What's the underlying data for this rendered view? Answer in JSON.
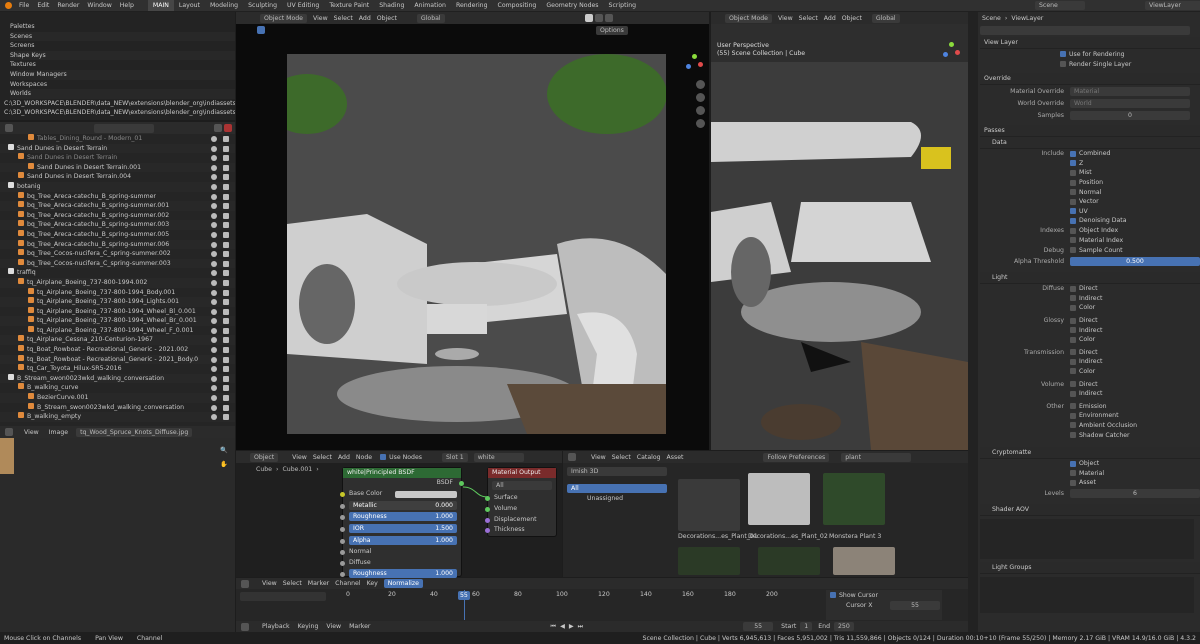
{
  "topbar": {
    "menus": [
      "File",
      "Edit",
      "Render",
      "Window",
      "Help"
    ],
    "workspaces": [
      "MAIN",
      "Layout",
      "Modeling",
      "Sculpting",
      "UV Editing",
      "Texture Paint",
      "Shading",
      "Animation",
      "Rendering",
      "Compositing",
      "Geometry Nodes",
      "Scripting"
    ],
    "active_workspace": "MAIN",
    "scene": "Scene",
    "view_layer": "ViewLayer"
  },
  "blendfile": {
    "items": [
      "Palettes",
      "Scenes",
      "Screens",
      "Shape Keys",
      "Textures",
      "Window Managers",
      "Workspaces",
      "Worlds"
    ],
    "paths": [
      "C:\\3D_WORKSPACE\\BLENDER\\data_NEW\\extensions\\blender_org\\indiassets\\hole_gen",
      "C:\\3D_WORKSPACE\\BLENDER\\data_NEW\\extensions\\blender_org\\indiassets\\pipe_gen"
    ]
  },
  "outliner": {
    "rows": [
      {
        "label": "Tables_Dining_Round - Modern_01",
        "indent": 2,
        "sel": false,
        "dim": true
      },
      {
        "label": "Sand Dunes in Desert Terrain",
        "indent": 0,
        "sel": false,
        "dim": false
      },
      {
        "label": "Sand Dunes in Desert Terrain",
        "indent": 1,
        "sel": false,
        "dim": true
      },
      {
        "label": "Sand Dunes in Desert Terrain.001",
        "indent": 2,
        "sel": false,
        "dim": false
      },
      {
        "label": "Sand Dunes in Desert Terrain.004",
        "indent": 1,
        "sel": false,
        "dim": false
      },
      {
        "label": "botanig",
        "indent": 0,
        "sel": false,
        "dim": false
      },
      {
        "label": "bq_Tree_Areca-catechu_B_spring-summer",
        "indent": 1,
        "sel": false,
        "dim": false
      },
      {
        "label": "bq_Tree_Areca-catechu_B_spring-summer.001",
        "indent": 1,
        "sel": false,
        "dim": false
      },
      {
        "label": "bq_Tree_Areca-catechu_B_spring-summer.002",
        "indent": 1,
        "sel": false,
        "dim": false
      },
      {
        "label": "bq_Tree_Areca-catechu_B_spring-summer.003",
        "indent": 1,
        "sel": false,
        "dim": false
      },
      {
        "label": "bq_Tree_Areca-catechu_B_spring-summer.005",
        "indent": 1,
        "sel": false,
        "dim": false
      },
      {
        "label": "bq_Tree_Areca-catechu_B_spring-summer.006",
        "indent": 1,
        "sel": false,
        "dim": false
      },
      {
        "label": "bq_Tree_Cocos-nucifera_C_spring-summer.002",
        "indent": 1,
        "sel": false,
        "dim": false
      },
      {
        "label": "bq_Tree_Cocos-nucifera_C_spring-summer.003",
        "indent": 1,
        "sel": false,
        "dim": false
      },
      {
        "label": "traffiq",
        "indent": 0,
        "sel": false,
        "dim": false
      },
      {
        "label": "tq_Airplane_Boeing_737-800-1994.002",
        "indent": 1,
        "sel": false,
        "dim": false
      },
      {
        "label": "tq_Airplane_Boeing_737-800-1994_Body.001",
        "indent": 2,
        "sel": false,
        "dim": false
      },
      {
        "label": "tq_Airplane_Boeing_737-800-1994_Lights.001",
        "indent": 2,
        "sel": false,
        "dim": false
      },
      {
        "label": "tq_Airplane_Boeing_737-800-1994_Wheel_Bl_0.001",
        "indent": 2,
        "sel": false,
        "dim": false
      },
      {
        "label": "tq_Airplane_Boeing_737-800-1994_Wheel_Br_0.001",
        "indent": 2,
        "sel": false,
        "dim": false
      },
      {
        "label": "tq_Airplane_Boeing_737-800-1994_Wheel_F_0.001",
        "indent": 2,
        "sel": false,
        "dim": false
      },
      {
        "label": "tq_Airplane_Cessna_210-Centurion-1967",
        "indent": 1,
        "sel": false,
        "dim": false
      },
      {
        "label": "tq_Boat_Rowboat - Recreational_Generic - 2021.002",
        "indent": 1,
        "sel": false,
        "dim": false
      },
      {
        "label": "tq_Boat_Rowboat - Recreational_Generic - 2021_Body.0",
        "indent": 1,
        "sel": false,
        "dim": false
      },
      {
        "label": "tq_Car_Toyota_Hilux-SR5-2016",
        "indent": 1,
        "sel": false,
        "dim": false
      },
      {
        "label": "B_Stream_swon0023wkd_walking_conversation",
        "indent": 0,
        "sel": false,
        "dim": false
      },
      {
        "label": "B_walking_curve",
        "indent": 1,
        "sel": false,
        "dim": false
      },
      {
        "label": "BezierCurve.001",
        "indent": 2,
        "sel": false,
        "dim": false
      },
      {
        "label": "B_Stream_swon0023wkd_walking_conversation",
        "indent": 2,
        "sel": false,
        "dim": false
      },
      {
        "label": "B_walking_empty",
        "indent": 1,
        "sel": false,
        "dim": false
      }
    ]
  },
  "image_editor": {
    "menus": [
      "View",
      "Image"
    ],
    "image": "tq_Wood_Spruce_Knots_Diffuse.jpg"
  },
  "viewport_left": {
    "mode": "Object Mode",
    "menus": [
      "View",
      "Select",
      "Add",
      "Object"
    ],
    "orientation": "Global",
    "options": "Options"
  },
  "viewport_right": {
    "mode": "Object Mode",
    "menus": [
      "View",
      "Select",
      "Add",
      "Object"
    ],
    "orientation": "Global",
    "title": "User Perspective",
    "subtitle": "(55) Scene Collection | Cube"
  },
  "node_editor": {
    "menus": [
      "Object",
      "View",
      "Select",
      "Add",
      "Node"
    ],
    "use_nodes": "Use Nodes",
    "slot": "Slot 1",
    "material": "white",
    "breadcrumb": [
      "Cube",
      "Cube.001",
      "white"
    ],
    "bsdf": {
      "title": "white|Principled BSDF",
      "output": "BSDF",
      "rows": [
        {
          "label": "Base Color",
          "value": ""
        },
        {
          "label": "Metallic",
          "value": "0.000"
        },
        {
          "label": "Roughness",
          "value": "1.000"
        },
        {
          "label": "IOR",
          "value": "1.500"
        },
        {
          "label": "Alpha",
          "value": "1.000"
        },
        {
          "label": "Normal",
          "value": ""
        },
        {
          "label": "Diffuse",
          "value": ""
        },
        {
          "label": "Roughness",
          "value": "1.000"
        }
      ]
    },
    "output": {
      "title": "Material Output",
      "target": "All",
      "sockets": [
        "Surface",
        "Volume",
        "Displacement",
        "Thickness"
      ]
    }
  },
  "asset_browser": {
    "menus": [
      "View",
      "Select",
      "Catalog",
      "Asset"
    ],
    "library": "Imish 3D",
    "follow": "Follow Preferences",
    "search": "plant",
    "catalogs": [
      "All",
      "Unassigned"
    ],
    "assets": [
      "Decorations...es_Plant_01",
      "Decorations...es_Plant_02",
      "Monstera Plant 3"
    ]
  },
  "properties": {
    "viewlayer": "ViewLayer",
    "scene_label": "Scene",
    "use_for_rendering": "Use for Rendering",
    "render_single": "Render Single Layer",
    "override": {
      "title": "Override",
      "material": "Material Override",
      "material_ph": "Material",
      "world": "World Override",
      "world_ph": "World",
      "samples": "Samples",
      "samples_val": "0"
    },
    "passes": "Passes",
    "data": "Data",
    "include_label": "Include",
    "include": [
      {
        "t": "Combined",
        "on": true
      },
      {
        "t": "Z",
        "on": true
      },
      {
        "t": "Mist",
        "on": false
      },
      {
        "t": "Position",
        "on": false
      },
      {
        "t": "Normal",
        "on": false
      },
      {
        "t": "Vector",
        "on": false
      },
      {
        "t": "UV",
        "on": true
      },
      {
        "t": "Denoising Data",
        "on": true
      }
    ],
    "indexes_label": "Indexes",
    "indexes": [
      "Object Index",
      "Material Index"
    ],
    "debug_label": "Debug",
    "debug": "Sample Count",
    "alpha_label": "Alpha Threshold",
    "alpha_val": "0.500",
    "light": "Light",
    "diffuse_label": "Diffuse",
    "glossy_label": "Glossy",
    "trans_label": "Transmission",
    "volume_label": "Volume",
    "other_label": "Other",
    "light_opts": [
      "Direct",
      "Indirect",
      "Color"
    ],
    "volume_opts": [
      "Direct",
      "Indirect"
    ],
    "other_opts": [
      "Emission",
      "Environment",
      "Ambient Occlusion",
      "Shadow Catcher"
    ],
    "cryptomatte": "Cryptomatte",
    "crypto": [
      {
        "t": "Object",
        "on": true
      },
      {
        "t": "Material",
        "on": false
      },
      {
        "t": "Asset",
        "on": false
      }
    ],
    "levels_label": "Levels",
    "levels_val": "6",
    "shader_aov": "Shader AOV",
    "light_groups": "Light Groups"
  },
  "timeline": {
    "menus": [
      "View",
      "Select",
      "Marker",
      "Channel",
      "Key"
    ],
    "mode": "Normalize",
    "ticks": [
      "0",
      "20",
      "40",
      "60",
      "80",
      "100",
      "120",
      "140",
      "160",
      "180",
      "200"
    ],
    "current": "55",
    "show_cursor": "Show Cursor",
    "cursor_x": "Cursor X",
    "cursor_val": "55",
    "footer": [
      "Playback",
      "Keying",
      "View",
      "Marker"
    ],
    "frame": "55",
    "start_label": "Start",
    "start": "1",
    "end_label": "End",
    "end": "250"
  },
  "statusbar": {
    "left": [
      "Mouse Click on Channels",
      "Pan View",
      "Channel"
    ],
    "right": "Scene Collection | Cube | Verts 6,945,613 | Faces 5,951,002 | Tris 11,559,866 | Objects 0/124 | Duration 00:10+10 (Frame 55/250) | Memory 2.17 GiB | VRAM 14.9/16.0 GiB | 4.3.2"
  },
  "colors": {
    "accent": "#4772b3",
    "node_header_green": "#2d6a34",
    "node_header_red": "#7a2b2b",
    "timeline_playhead": "#4772b3"
  }
}
